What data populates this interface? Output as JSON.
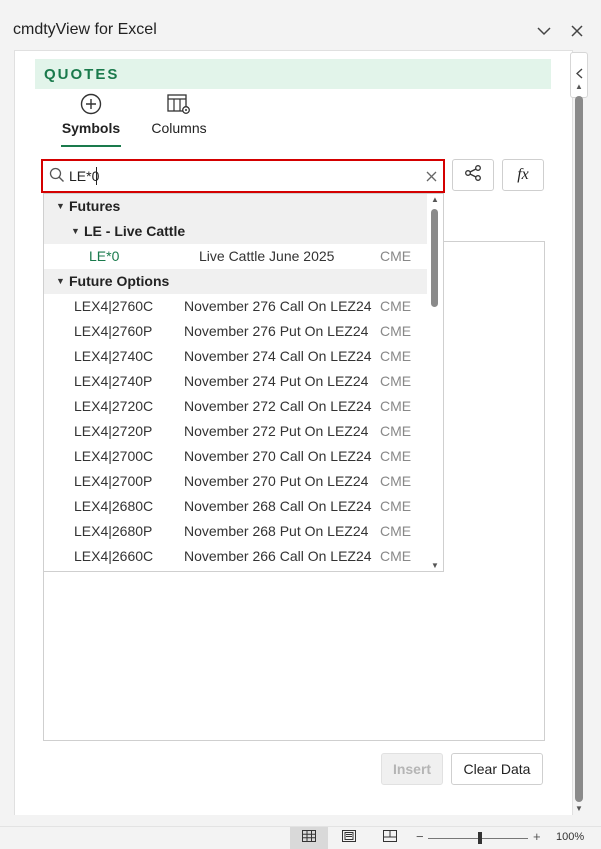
{
  "app": {
    "title": "cmdtyView for Excel"
  },
  "section": {
    "label": "QUOTES"
  },
  "tabs": [
    {
      "label": "Symbols"
    },
    {
      "label": "Columns"
    }
  ],
  "search": {
    "value": "LE*0"
  },
  "dropdown": {
    "group1": "Futures",
    "subgroup1": "LE - Live Cattle",
    "selected": {
      "symbol": "LE*0",
      "desc": "Live Cattle June 2025",
      "exchange": "CME"
    },
    "group2": "Future Options",
    "options": [
      {
        "symbol": "LEX4|2760C",
        "desc": "November 276 Call On LEZ24",
        "exchange": "CME"
      },
      {
        "symbol": "LEX4|2760P",
        "desc": "November 276 Put On LEZ24",
        "exchange": "CME"
      },
      {
        "symbol": "LEX4|2740C",
        "desc": "November 274 Call On LEZ24",
        "exchange": "CME"
      },
      {
        "symbol": "LEX4|2740P",
        "desc": "November 274 Put On LEZ24",
        "exchange": "CME"
      },
      {
        "symbol": "LEX4|2720C",
        "desc": "November 272 Call On LEZ24",
        "exchange": "CME"
      },
      {
        "symbol": "LEX4|2720P",
        "desc": "November 272 Put On LEZ24",
        "exchange": "CME"
      },
      {
        "symbol": "LEX4|2700C",
        "desc": "November 270 Call On LEZ24",
        "exchange": "CME"
      },
      {
        "symbol": "LEX4|2700P",
        "desc": "November 270 Put On LEZ24",
        "exchange": "CME"
      },
      {
        "symbol": "LEX4|2680C",
        "desc": "November 268 Call On LEZ24",
        "exchange": "CME"
      },
      {
        "symbol": "LEX4|2680P",
        "desc": "November 268 Put On LEZ24",
        "exchange": "CME"
      },
      {
        "symbol": "LEX4|2660C",
        "desc": "November 266 Call On LEZ24",
        "exchange": "CME"
      }
    ]
  },
  "buttons": {
    "insert": "Insert",
    "clear": "Clear Data",
    "fx": "fx"
  },
  "status": {
    "zoom": "100%",
    "minus": "−",
    "plus": "+"
  },
  "colors": {
    "accent": "#1a7a4c",
    "highlight": "#d40000",
    "band": "#e2f4ea"
  }
}
